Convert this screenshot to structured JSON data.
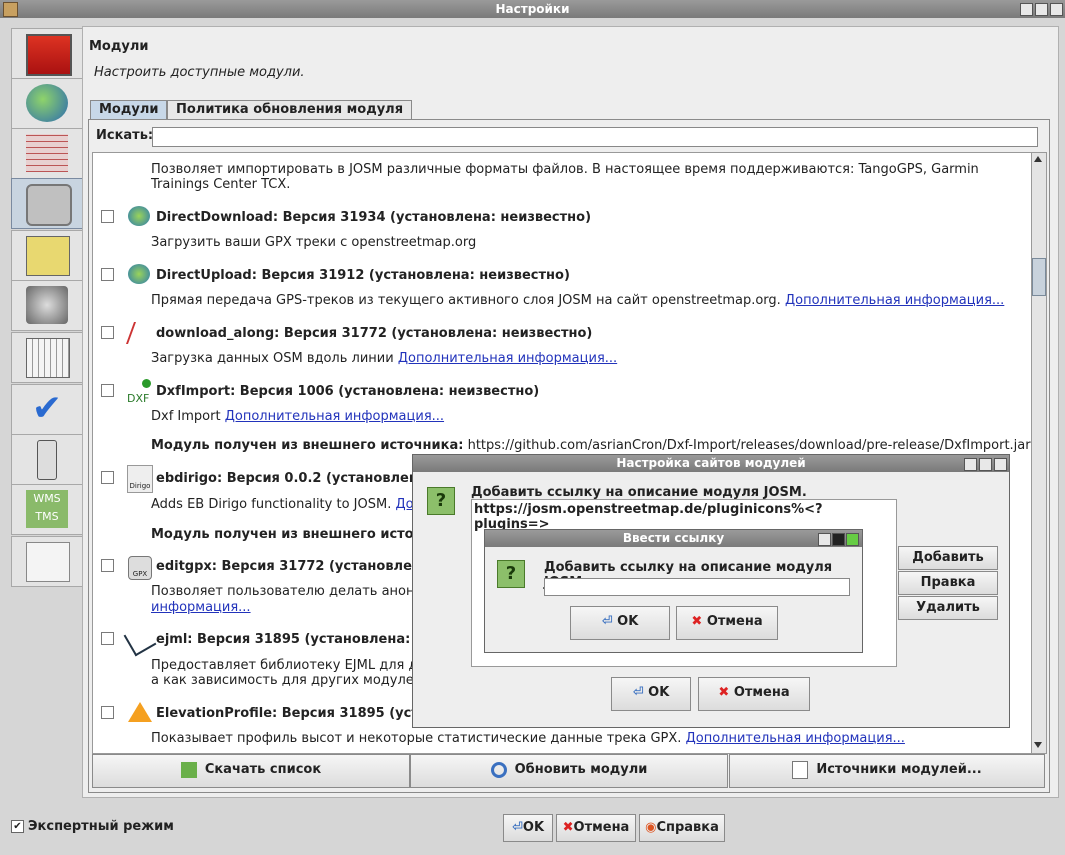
{
  "window": {
    "title": "Настройки"
  },
  "header": {
    "title": "Модули",
    "subtitle": "Настроить доступные модули."
  },
  "tabs": [
    {
      "label": "Модули"
    },
    {
      "label": "Политика обновления модуля"
    }
  ],
  "search": {
    "label": "Искать:",
    "value": ""
  },
  "sidebar_icons": [
    "display-prefs-icon",
    "globe-icon",
    "grid-icon",
    "plugin-socket-icon",
    "toolbar-icon",
    "audio-speaker-icon",
    "keyboard-icon",
    "validator-check-icon",
    "remote-control-icon",
    "wms-tms-icon",
    "advanced-wrench-icon"
  ],
  "plugins": {
    "intro": "Позволяет импортировать в JOSM различные форматы файлов. В настоящее время поддерживаются: TangoGPS, Garmin",
    "intro2": "Trainings Center TCX.",
    "p1": {
      "title": "DirectDownload: Версия 31934 (установлена: неизвестно)",
      "desc": "Загрузить ваши GPX треки с openstreetmap.org"
    },
    "p2": {
      "title": "DirectUpload: Версия 31912 (установлена: неизвестно)",
      "desc": "Прямая передача GPS-треков из текущего активного слоя JOSM на сайт openstreetmap.org.",
      "link": "Дополнительная информация..."
    },
    "p3": {
      "title": "download_along: Версия 31772 (установлена: неизвестно)",
      "desc": "Загрузка данных OSM вдоль линии",
      "link": "Дополнительная информация..."
    },
    "p4": {
      "title": "DxfImport: Версия 1006 (установлена: неизвестно)",
      "desc": "Dxf Import",
      "link": "Дополнительная информация...",
      "ext_label": "Модуль получен из внешнего источника:",
      "ext_url": "https://github.com/asrianCron/Dxf-Import/releases/download/pre-release/DxfImport.jar",
      "icon_text": "DXF"
    },
    "p5": {
      "title": "ebdirigo: Версия 0.0.2 (установлена:",
      "desc": "Adds EB Dirigo functionality to JOSM.",
      "link": "Доп",
      "ext_label": "Модуль получен из внешнего источни",
      "icon_text": "Dirigo"
    },
    "p6": {
      "title": "editgpx: Версия 31772 (установле",
      "desc": "Позволяет пользователю делать анони",
      "link": "информация...",
      "icon_text": "GPX"
    },
    "p7": {
      "title": "ejml: Версия 31895 (установлена: не",
      "desc": "Предоставляет библиотеку EJML для д",
      "desc2": "а как зависимость для других модулей"
    },
    "p8": {
      "title": "ElevationProfile: Версия 31895 (устан",
      "desc": "Показывает профиль высот и некоторые статистические данные трека GPX.",
      "link": "Дополнительная информация..."
    }
  },
  "bottom_buttons": {
    "download": "Скачать список",
    "update": "Обновить модули",
    "sources": "Источники модулей..."
  },
  "footer": {
    "expert_label": "Экспертный режим",
    "expert_checked": true,
    "ok": "OK",
    "cancel": "Отмена",
    "help": "Справка"
  },
  "sites_dialog": {
    "title": "Настройка сайтов модулей",
    "prompt": "Добавить ссылку на описание модуля JOSM.",
    "list_item": "https://josm.openstreetmap.de/pluginicons%<?plugins=>",
    "add": "Добавить",
    "edit": "Правка",
    "delete": "Удалить",
    "ok": "OK",
    "cancel": "Отмена"
  },
  "link_dialog": {
    "title": "Ввести ссылку",
    "prompt": "Добавить ссылку на описание модуля JOSM.",
    "value": "",
    "ok": "OK",
    "cancel": "Отмена"
  }
}
